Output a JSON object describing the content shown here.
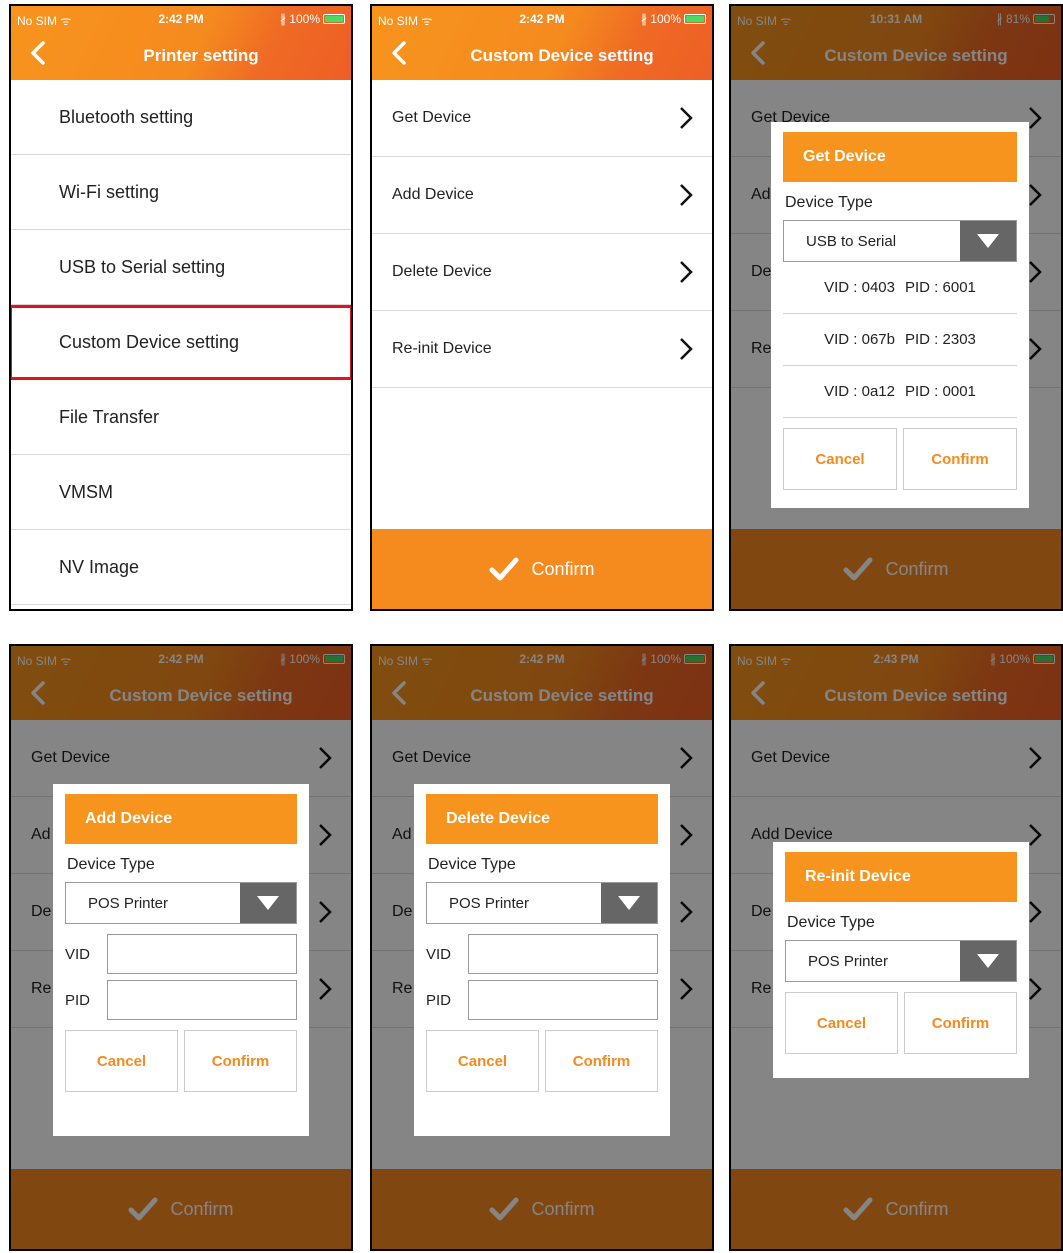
{
  "colors": {
    "accent": "#f7941d",
    "highlight": "#e4131b",
    "check": "#4cd964"
  },
  "p1": {
    "status": {
      "carrier": "No SIM ᯤ",
      "time": "2:42 PM",
      "battery": "∦ 100%",
      "level": 1.0
    },
    "title": "Printer setting",
    "items": [
      "Bluetooth setting",
      "Wi-Fi setting",
      "USB to Serial setting",
      "Custom Device setting",
      "File Transfer",
      "VMSM",
      "NV Image"
    ]
  },
  "p2": {
    "status": {
      "carrier": "No SIM ᯤ",
      "time": "2:42 PM",
      "battery": "∦ 100%",
      "level": 1.0
    },
    "title": "Custom Device setting",
    "items": [
      "Get Device",
      "Add Device",
      "Delete Device",
      "Re-init Device"
    ],
    "confirm": "Confirm"
  },
  "p3": {
    "status": {
      "carrier": "No SIM ᯤ",
      "time": "10:31 AM",
      "battery": "∦ 81%",
      "level": 0.81
    },
    "title": "Custom Device setting",
    "items": [
      "Get Device",
      "Ad",
      "De",
      "Re"
    ],
    "confirm": "Confirm",
    "dialog": {
      "header": "Get Device",
      "device_type_label": "Device Type",
      "selected": "USB to Serial",
      "devices": [
        {
          "vid": "VID : 0403",
          "pid": "PID : 6001"
        },
        {
          "vid": "VID : 067b",
          "pid": "PID : 2303"
        },
        {
          "vid": "VID : 0a12",
          "pid": "PID : 0001"
        }
      ],
      "cancel": "Cancel",
      "confirm": "Confirm"
    }
  },
  "p4": {
    "status": {
      "carrier": "No SIM ᯤ",
      "time": "2:42 PM",
      "battery": "∦ 100%",
      "level": 1.0
    },
    "title": "Custom Device setting",
    "items": [
      "Get Device",
      "Ad",
      "De",
      "Re"
    ],
    "confirm": "Confirm",
    "dialog": {
      "header": "Add Device",
      "device_type_label": "Device Type",
      "selected": "POS Printer",
      "vid_label": "VID",
      "pid_label": "PID",
      "cancel": "Cancel",
      "confirm": "Confirm"
    }
  },
  "p5": {
    "status": {
      "carrier": "No SIM ᯤ",
      "time": "2:42 PM",
      "battery": "∦ 100%",
      "level": 1.0
    },
    "title": "Custom Device setting",
    "items": [
      "Get Device",
      "Ad",
      "De",
      "Re"
    ],
    "confirm": "Confirm",
    "dialog": {
      "header": "Delete Device",
      "device_type_label": "Device Type",
      "selected": "POS Printer",
      "vid_label": "VID",
      "pid_label": "PID",
      "cancel": "Cancel",
      "confirm": "Confirm"
    }
  },
  "p6": {
    "status": {
      "carrier": "No SIM ᯤ",
      "time": "2:43 PM",
      "battery": "∦ 100%",
      "level": 1.0
    },
    "title": "Custom Device setting",
    "items": [
      "Get Device",
      "Add Device",
      "De",
      "Re"
    ],
    "confirm": "Confirm",
    "dialog": {
      "header": "Re-init Device",
      "device_type_label": "Device Type",
      "selected": "POS Printer",
      "cancel": "Cancel",
      "confirm": "Confirm"
    }
  }
}
